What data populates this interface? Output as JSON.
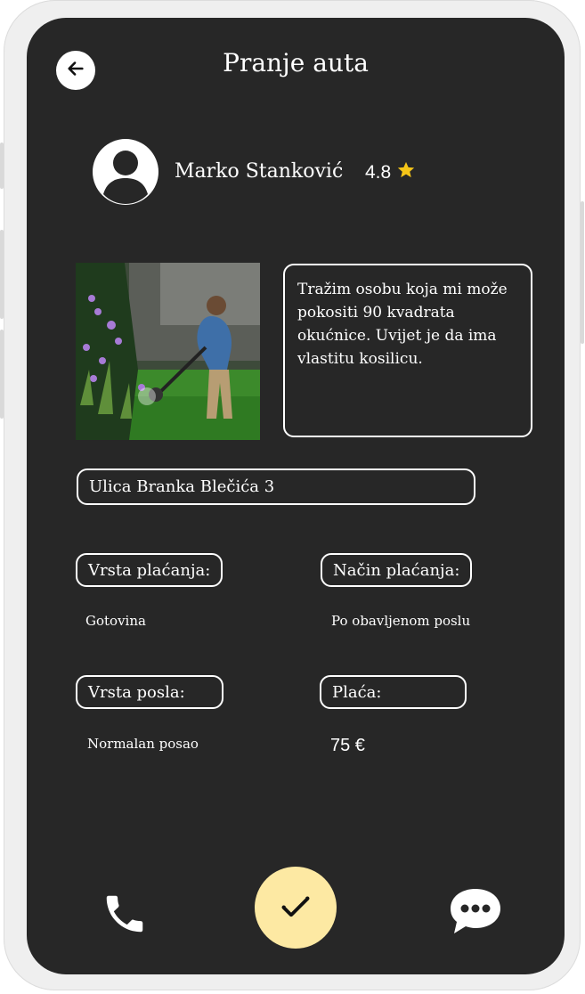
{
  "header": {
    "title": "Pranje auta"
  },
  "user": {
    "name": "Marko Stanković",
    "rating": "4.8"
  },
  "job": {
    "description": "Tražim osobu koja mi može pokositi 90 kvadrata okućnice. Uvijet je da ima vlastitu kosilicu.",
    "address": "Ulica Branka Blečića 3"
  },
  "details": {
    "payment_type_label": "Vrsta plaćanja:",
    "payment_type_value": "Gotovina",
    "payment_method_label": "Način plaćanja:",
    "payment_method_value": "Po obavljenom poslu",
    "job_type_label": "Vrsta posla:",
    "job_type_value": "Normalan posao",
    "salary_label": "Plaća:",
    "salary_value": "75 €"
  },
  "icons": {
    "back": "arrow-left-icon",
    "star": "star-icon",
    "phone": "phone-icon",
    "accept": "checkmark-icon",
    "chat": "chat-bubble-icon"
  },
  "colors": {
    "screen_bg": "#272727",
    "accent": "#fde9a3",
    "star": "#f5c518"
  }
}
